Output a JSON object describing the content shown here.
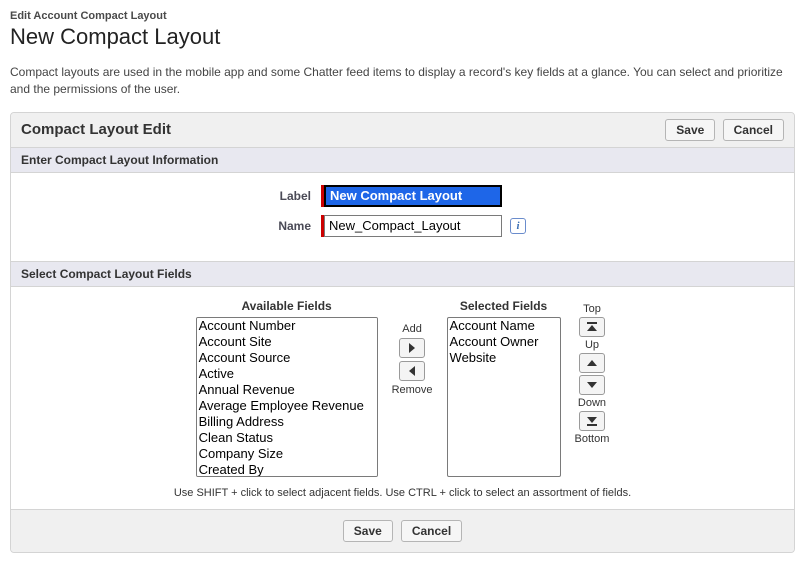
{
  "page": {
    "super_title": "Edit Account Compact Layout",
    "title": "New Compact Layout",
    "description": "Compact layouts are used in the mobile app and some Chatter feed items to display a record's key fields at a glance. You can select and prioritize and the permissions of the user."
  },
  "panel": {
    "title": "Compact Layout Edit",
    "save_label": "Save",
    "cancel_label": "Cancel"
  },
  "sections": {
    "info_title": "Enter Compact Layout Information",
    "fields_title": "Select Compact Layout Fields"
  },
  "form": {
    "label_label": "Label",
    "label_value": "New Compact Layout",
    "name_label": "Name",
    "name_value": "New_Compact_Layout"
  },
  "dual_list": {
    "available_title": "Available Fields",
    "selected_title": "Selected Fields",
    "available": [
      "Account Number",
      "Account Site",
      "Account Source",
      "Active",
      "Annual Revenue",
      "Average Employee Revenue",
      "Billing Address",
      "Clean Status",
      "Company Size",
      "Created By"
    ],
    "selected": [
      "Account Name",
      "Account Owner",
      "Website"
    ],
    "add_label": "Add",
    "remove_label": "Remove",
    "top_label": "Top",
    "up_label": "Up",
    "down_label": "Down",
    "bottom_label": "Bottom",
    "hint": "Use SHIFT + click to select adjacent fields. Use CTRL + click to select an assortment of fields."
  }
}
